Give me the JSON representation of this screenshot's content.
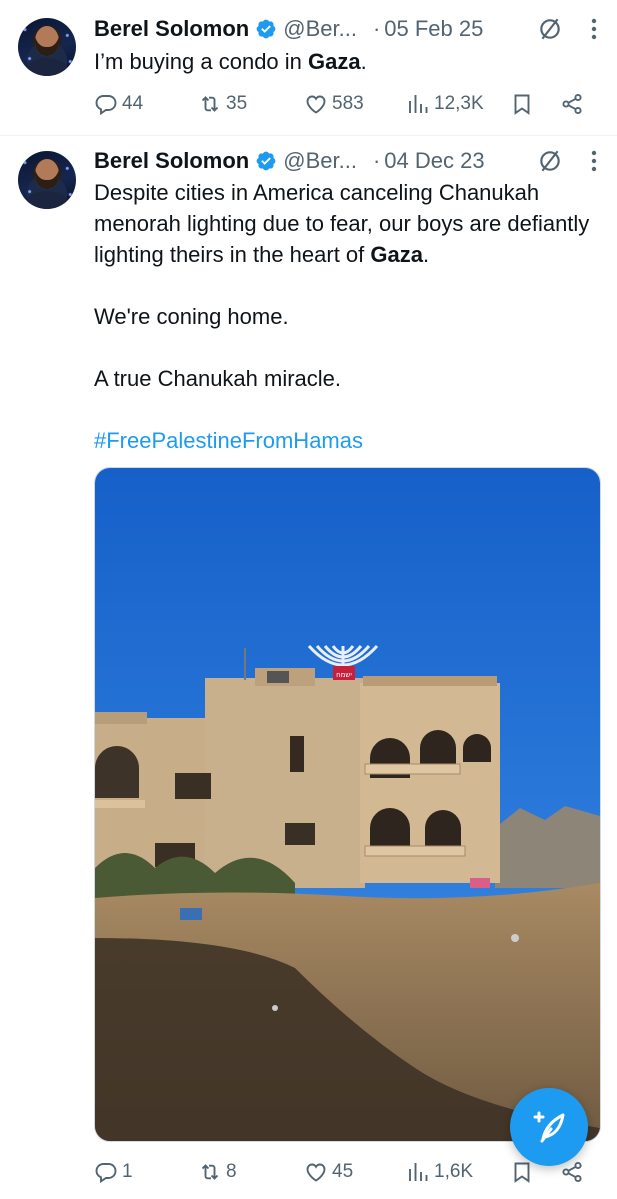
{
  "tweets": [
    {
      "author": "Berel Solomon",
      "handle": "@Ber...",
      "dot": "·",
      "date": "05 Feb 25",
      "text_before": "I’m buying a condo in ",
      "text_bold": "Gaza",
      "text_after": ".",
      "replies": "44",
      "reposts": "35",
      "likes": "583",
      "views": "12,3K"
    },
    {
      "author": "Berel Solomon",
      "handle": "@Ber...",
      "dot": "·",
      "date": "04 Dec 23",
      "para1_before": "Despite cities in America canceling Chanukah menorah lighting due to fear, our boys are defiantly lighting theirs in the heart of ",
      "para1_bold": "Gaza",
      "para1_after": ".",
      "para2": "We're coning home.",
      "para3": "A true Chanukah miracle.",
      "hashtag": "#FreePalestineFromHamas",
      "replies": "1",
      "reposts": "8",
      "likes": "45",
      "views": "1,6K"
    }
  ],
  "colors": {
    "accent": "#1d9bf0",
    "secondary_text": "#536471",
    "primary_text": "#0f1419"
  },
  "icons": [
    "verified-badge-icon",
    "grok-icon",
    "more-icon",
    "reply-icon",
    "repost-icon",
    "like-icon",
    "views-icon",
    "bookmark-icon",
    "share-icon",
    "compose-icon"
  ],
  "photo_sign": "ישמח"
}
